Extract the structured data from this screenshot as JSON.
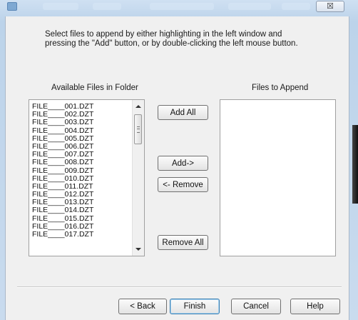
{
  "window": {
    "close_glyph": "☒",
    "accent_color": "#bcd3ea"
  },
  "instructions": "Select files to append by either highlighting in the left window and pressing the \"Add\" button, or by double-clicking the left mouse button.",
  "labels": {
    "available": "Available Files in Folder",
    "append": "Files to Append"
  },
  "available_files": [
    "FILE____001.DZT",
    "FILE____002.DZT",
    "FILE____003.DZT",
    "FILE____004.DZT",
    "FILE____005.DZT",
    "FILE____006.DZT",
    "FILE____007.DZT",
    "FILE____008.DZT",
    "FILE____009.DZT",
    "FILE____010.DZT",
    "FILE____011.DZT",
    "FILE____012.DZT",
    "FILE____013.DZT",
    "FILE____014.DZT",
    "FILE____015.DZT",
    "FILE____016.DZT",
    "FILE____017.DZT"
  ],
  "files_to_append": [],
  "buttons": {
    "add_all": "Add All",
    "add": "Add->",
    "remove": "<- Remove",
    "remove_all": "Remove All",
    "back": "< Back",
    "finish": "Finish",
    "cancel": "Cancel",
    "help": "Help"
  }
}
